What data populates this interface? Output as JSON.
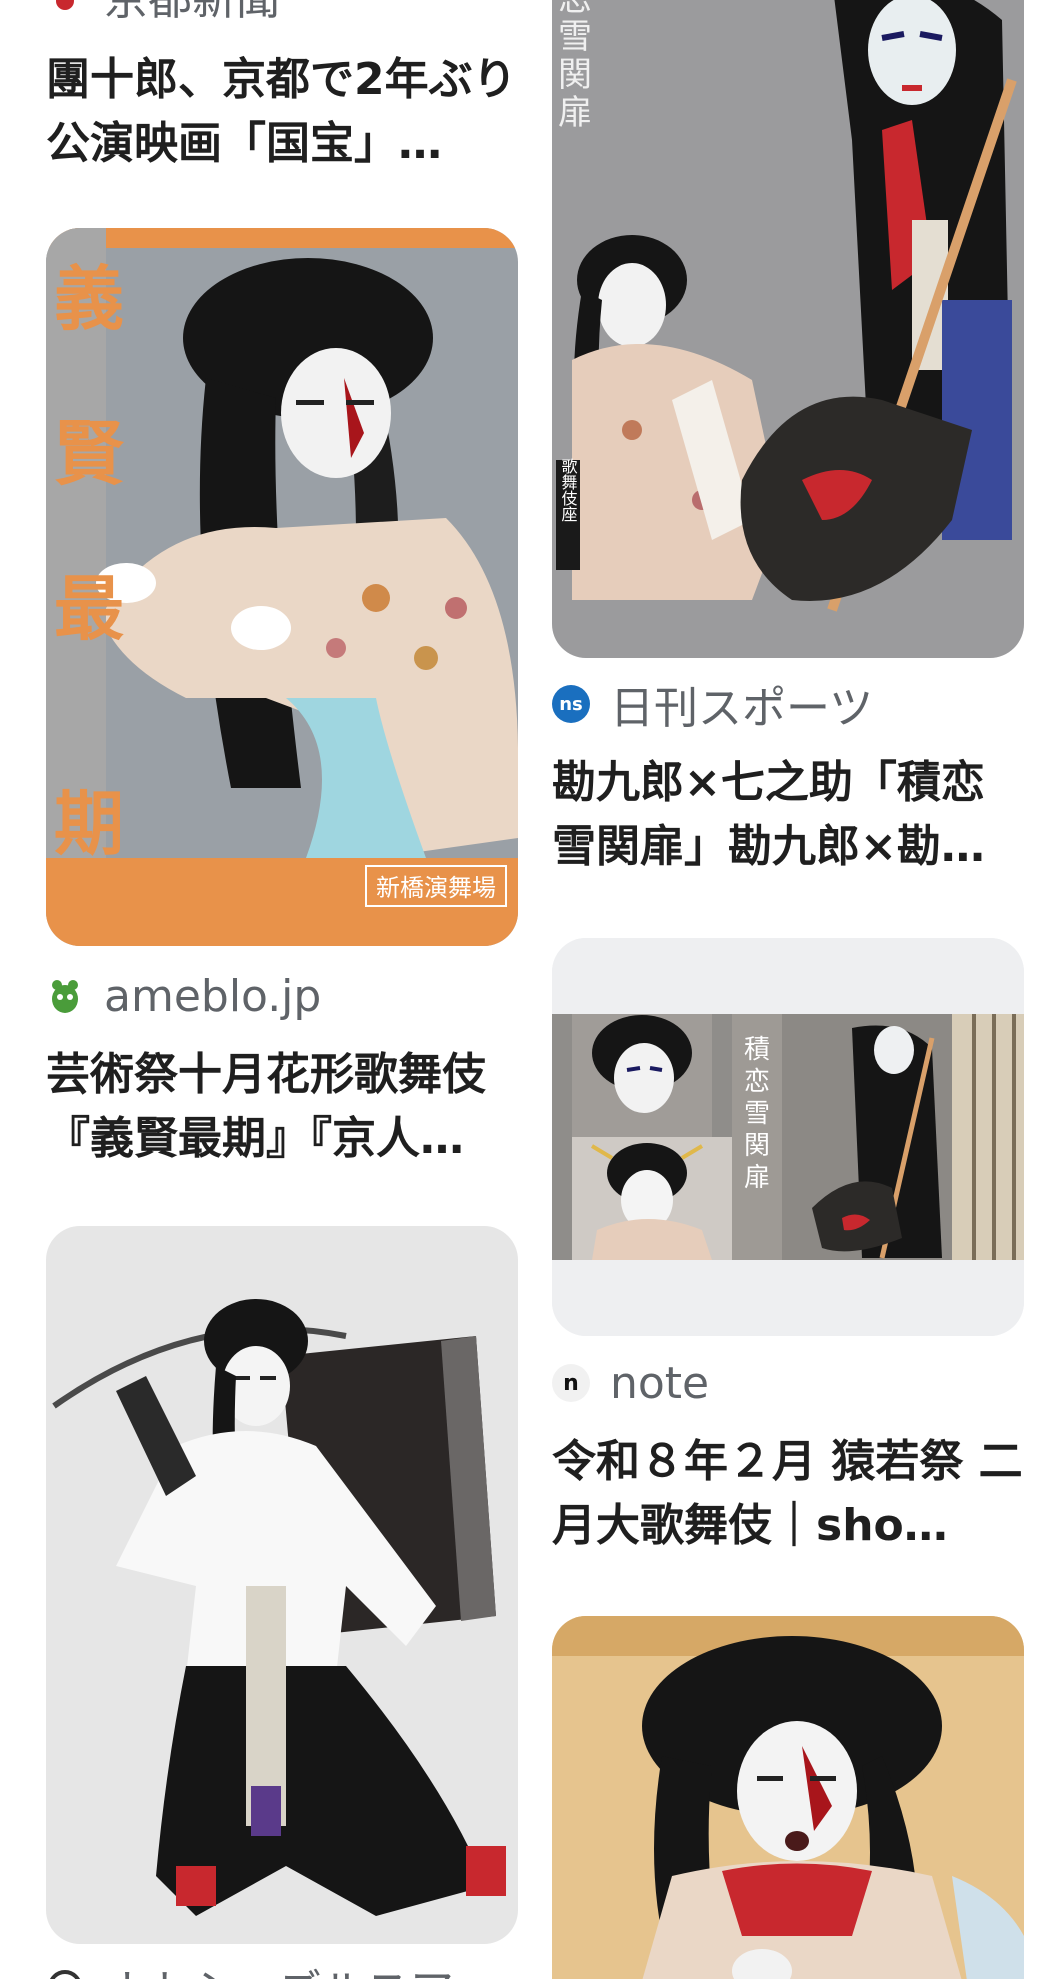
{
  "cards": {
    "kyoto": {
      "source": "京都新聞",
      "title": "團十郎、京都で2年ぶり公演映画「国宝」…"
    },
    "ameblo": {
      "source": "ameblo.jp",
      "title": "芸術祭十月花形歌舞伎『義賢最期』『京人…",
      "poster_title_chars": [
        "義",
        "賢",
        "最",
        "期"
      ],
      "poster_venue": "新橋演舞場"
    },
    "nikkan": {
      "source": "日刊スポーツ",
      "favicon_text": "ns",
      "title": "勘九郎×七之助「積恋雪関扉」勘九郎×勘…",
      "poster_title_chars": [
        "恋",
        "雪",
        "関",
        "扉"
      ],
      "poster_tag": "歌舞伎座"
    },
    "note": {
      "source": "note",
      "favicon_text": "n",
      "title": "令和８年２月 猿若祭 二月大歌舞伎｜sho…",
      "poster_title_chars": [
        "積",
        "恋",
        "雪",
        "関",
        "扉"
      ]
    },
    "bottom_left": {
      "source": "ナトシーズルスア"
    }
  },
  "colors": {
    "source_text": "#5f6368",
    "title_text": "#1f1f1f",
    "poster_orange": "#e8924a",
    "kabuki_red": "#c8282e"
  }
}
